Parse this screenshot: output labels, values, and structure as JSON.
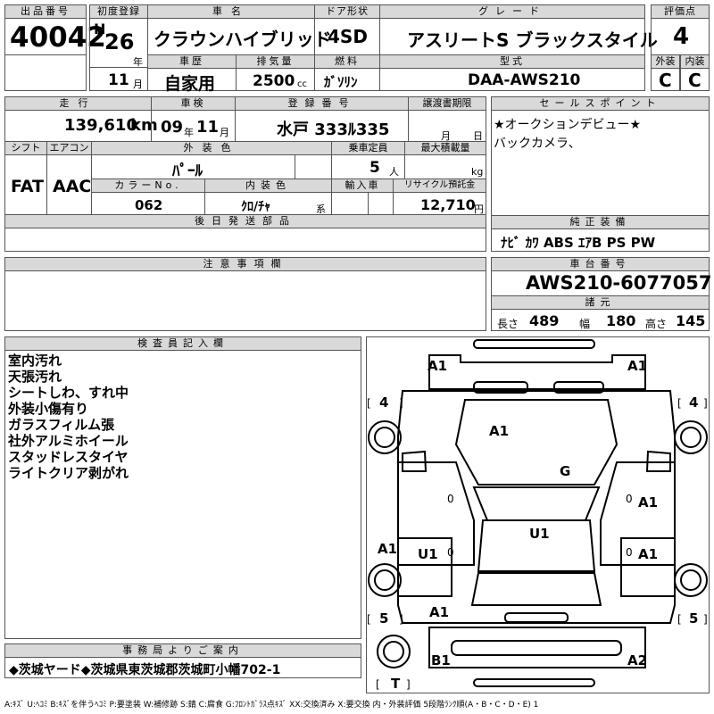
{
  "header": {
    "lot_label": "出品番号",
    "lot_no": "40042",
    "first_reg_label": "初度登録",
    "era": "H",
    "year": "26",
    "year_unit": "年",
    "month": "11",
    "month_unit": "月",
    "name_label": "車名",
    "name": "クラウンハイブリッド",
    "door_label": "ドア形状",
    "door": "4SD",
    "grade_label": "グレード",
    "grade": "アスリートS ブラックスタイル",
    "score_label": "評価点",
    "score": "4",
    "history_label": "車歴",
    "history": "自家用",
    "disp_label": "排気量",
    "disp": "2500",
    "disp_unit": "cc",
    "fuel_label": "燃料",
    "fuel": "ｶﾞｿﾘﾝ",
    "model_label": "型式",
    "model": "DAA-AWS210",
    "ext_label": "外装",
    "ext": "C",
    "int_label": "内装",
    "int": "C"
  },
  "row2": {
    "mileage_label": "走行",
    "mileage": "139,610",
    "mileage_unit": "km",
    "inspection_label": "車検",
    "insp_year": "09",
    "insp_year_unit": "年",
    "insp_month": "11",
    "insp_month_unit": "月",
    "reg_label": "登録番号",
    "reg": "水戸 333ﾙ335",
    "transfer_label": "譲渡書期限",
    "transfer_month_unit": "月",
    "transfer_day_unit": "日",
    "shift_label": "シフト",
    "shift": "FAT",
    "ac_label": "エアコン",
    "ac": "AAC",
    "color_label": "外装色",
    "color": "ﾊﾟｰﾙ",
    "capacity_label": "乗車定員",
    "capacity": "5",
    "capacity_unit": "人",
    "load_label": "最大積載量",
    "load_unit": "kg",
    "color_no_label": "カラーNo.",
    "color_no": "062",
    "interior_color_label": "内装色",
    "interior_color": "ｸﾛ/ﾁｬ",
    "interior_color_unit": "系",
    "import_label": "輸入車",
    "recycle_label": "リサイクル預託金",
    "recycle": "12,710",
    "recycle_unit": "円",
    "later_label": "後日発送部品"
  },
  "sales": {
    "label": "セールスポイント",
    "lines": [
      "★オークションデビュー★",
      "バックカメラ、"
    ]
  },
  "equipment": {
    "label": "純正装備",
    "value": "ﾅﾋﾞ ｶﾜ ABS ｴｱB PS PW"
  },
  "notes": {
    "label": "注意事項欄"
  },
  "chassis": {
    "label": "車台番号",
    "value": "AWS210-6077057",
    "specs_label": "諸元",
    "length_label": "長さ",
    "length": "489",
    "width_label": "幅",
    "width": "180",
    "height_label": "高さ",
    "height": "145"
  },
  "inspector": {
    "label": "検査員記入欄",
    "lines": [
      "室内汚れ",
      "天張汚れ",
      "シートしわ、すれ中",
      "外装小傷有り",
      "ガラスフィルム張",
      "社外アルミホイール",
      "スタッドレスタイヤ",
      "ライトクリア剥がれ"
    ]
  },
  "office": {
    "label": "事務局よりご案内",
    "value": "◆茨城ヤード◆茨城県東茨城郡茨城町小幡702-1"
  },
  "diagram": {
    "marks": {
      "front_left": "A1",
      "front_right": "A1",
      "hood": "A1",
      "windshield": "G",
      "fender_right": "A1",
      "door_front_left": "A1",
      "door_rear_left_inner": "U1",
      "roof": "U1",
      "door_rear_right": "A1",
      "rear_left": "A1",
      "rear_bumper_left": "B1",
      "rear_bumper_right": "A2"
    },
    "tires": {
      "fl": "4",
      "fr": "4",
      "rl": "5",
      "rr": "5",
      "spare": "T"
    },
    "door_marks": [
      "0",
      "0",
      "0",
      "0"
    ]
  },
  "legend": "A:ｷｽﾞ U:ﾍｺﾐ B:ｷｽﾞを伴うﾍｺﾐ P:要塗装 W:補修跡 S:錆 C:腐食 G:ﾌﾛﾝﾄｶﾞﾗｽ点ｷｽﾞ XX:交換済み X:要交換 内・外装評価 5段階ﾗﾝｸ順(A・B・C・D・E) 1"
}
